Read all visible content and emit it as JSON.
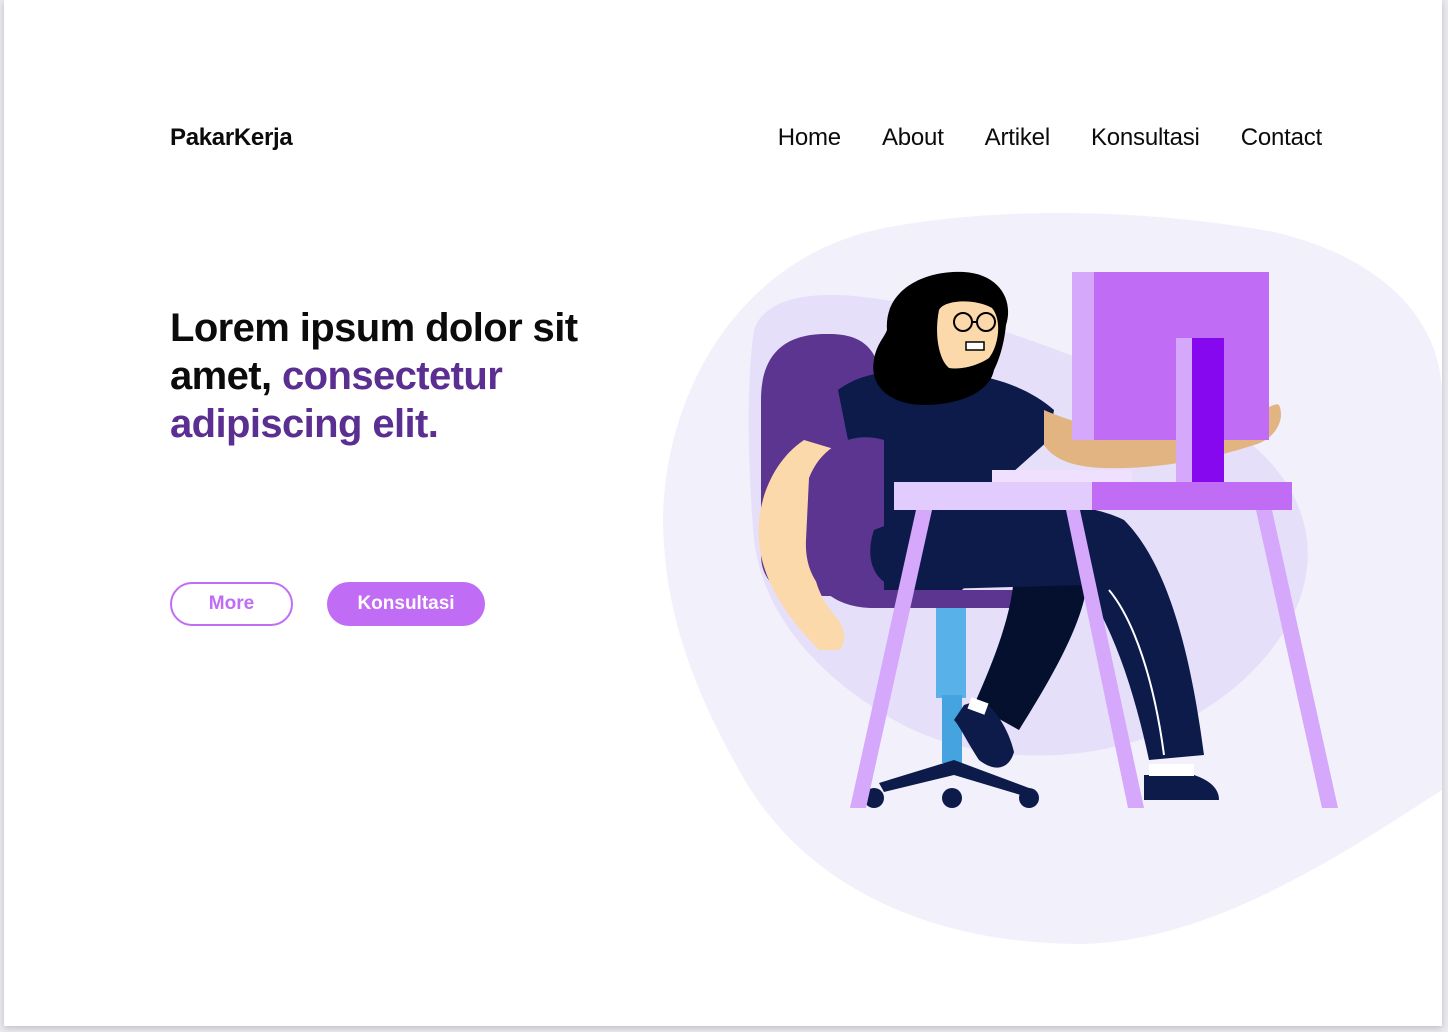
{
  "brand": "PakarKerja",
  "nav": {
    "items": [
      "Home",
      "About",
      "Artikel",
      "Konsultasi",
      "Contact"
    ]
  },
  "hero": {
    "headline_part1": "Lorem ipsum dolor sit amet, ",
    "headline_part2": "consectetur adipiscing elit.",
    "more_label": "More",
    "konsultasi_label": "Konsultasi"
  },
  "colors": {
    "accent": "#c06cf4",
    "headline_accent": "#5b2e91",
    "text": "#0b0b0b",
    "blob_bg": "#f2f0fa"
  }
}
